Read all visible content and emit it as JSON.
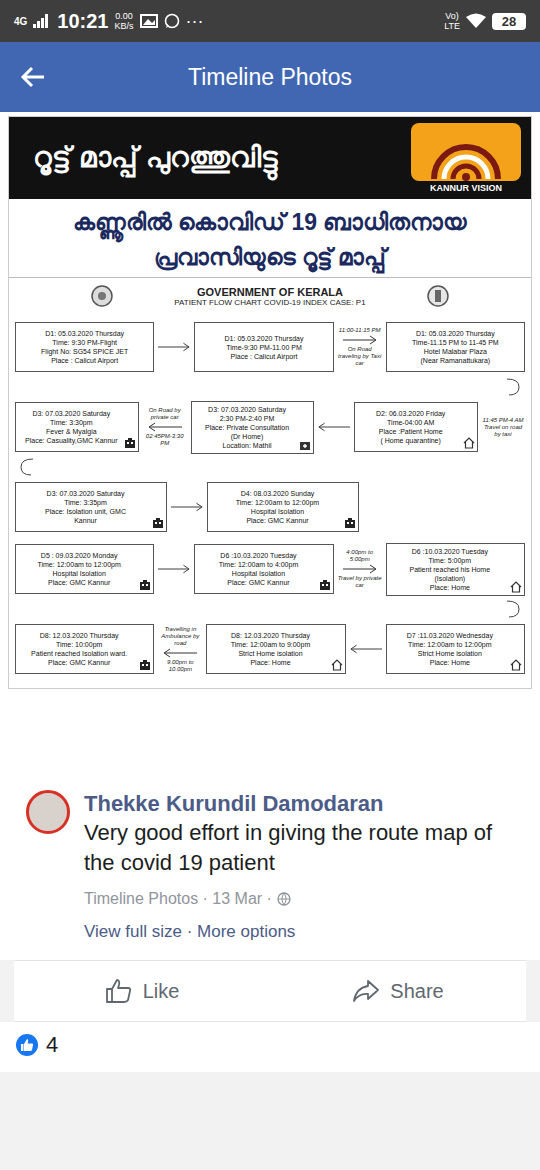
{
  "status_bar": {
    "network": "4G",
    "time": "10:21",
    "speed": "0.00",
    "speed_unit": "KB/s",
    "more": "···",
    "volte_top": "Vo)",
    "volte_bottom": "LTE",
    "battery": "28"
  },
  "app_bar": {
    "title": "Timeline Photos"
  },
  "photo": {
    "banner": "റൂട്ട് മാപ്പ് പുറത്തുവിട്ടു",
    "logo": "KANNUR VISION",
    "headline": [
      "കണ്ണൂരിൽ കൊവിഡ് 19 ബാധിതനായ",
      "പ്രവാസിയുടെ റൂട്ട് മാപ്പ്"
    ],
    "chart_title": "GOVERNMENT OF KERALA",
    "chart_subtitle": "PATIENT FLOW CHART COVID-19 INDEX CASE: P1",
    "rows": [
      {
        "turn": "right",
        "cells": [
          {
            "kind": "plain",
            "lines": [
              "D1: 05.03.2020 Thursday",
              "Time: 9:30 PM-Flight",
              "Flight No: SG54 SPICE JET",
              "Place : Calicut Airport"
            ]
          },
          {
            "kind": "arrow",
            "direction": "right",
            "labels": []
          },
          {
            "kind": "plain",
            "lines": [
              "D1: 05.03.2020 Thursday",
              "Time-9:30 PM-11.00 PM",
              "Place : Calicut Airport"
            ]
          },
          {
            "kind": "arrow",
            "direction": "right",
            "labels": [
              "11:00-11:15 PM",
              "On Road traveling by Taxi car"
            ]
          },
          {
            "kind": "plain",
            "lines": [
              "D1: 05.03.2020 Thursday",
              "Time-11.15 PM to 11-45 PM",
              "Hotel Malabar Plaza",
              "(Near Ramanattukara)"
            ]
          }
        ]
      },
      {
        "turn": "left",
        "cells": [
          {
            "kind": "hospital",
            "lines": [
              "D3: 07.03.2020 Saturday",
              "Time: 3:30pm",
              "Fever & Myalgia",
              "Place: Casuality,GMC Kannur"
            ]
          },
          {
            "kind": "arrow",
            "direction": "left",
            "labels": [
              "On Road by private car",
              "02:45PM-3:30 PM"
            ]
          },
          {
            "kind": "clinic",
            "lines": [
              "D3: 07.03.2020 Saturday",
              "2:30 PM-2:40 PM",
              "Place: Private Consultation",
              "(Dr Home)",
              "Location: Mathil"
            ]
          },
          {
            "kind": "arrow",
            "direction": "left",
            "labels": []
          },
          {
            "kind": "home",
            "lines": [
              "D2: 06.03.2020 Friday",
              "Time-04:00 AM",
              "Place :Patient Home",
              "( Home quarantine)"
            ]
          },
          {
            "kind": "note",
            "lines": [
              "11:45 PM-4 AM",
              "Travel on road by taxi"
            ]
          }
        ]
      },
      {
        "turn": "none",
        "cells": [
          {
            "kind": "hospital",
            "lines": [
              "D3: 07.03.2020 Saturday",
              "Time: 3:35pm",
              "Place: Isolation unit, GMC",
              "Kannur"
            ]
          },
          {
            "kind": "arrow",
            "direction": "right",
            "labels": []
          },
          {
            "kind": "hospital",
            "lines": [
              "D4: 08.03.2020 Sunday",
              "Time: 12:00am to 12:00pm",
              "Hospital Isolation",
              "Place: GMC Kannur"
            ]
          }
        ]
      },
      {
        "turn": "right",
        "cells": [
          {
            "kind": "hospital",
            "lines": [
              "D5 : 09.03.2020 Monday",
              "Time: 12:00am to 12:00pm",
              "Hospital Isolation",
              "Place: GMC Kannur"
            ]
          },
          {
            "kind": "arrow",
            "direction": "right",
            "labels": []
          },
          {
            "kind": "hospital",
            "lines": [
              "D6 :10.03.2020 Tuesday",
              "Time: 12:00am to 4:00pm",
              "Hospital Isolation",
              "Place: GMC Kannur"
            ]
          },
          {
            "kind": "arrow",
            "direction": "right",
            "labels": [
              "4:00pm to 5:00pm",
              "Travel by private car"
            ]
          },
          {
            "kind": "home",
            "lines": [
              "D6 :10.03.2020 Tuesday",
              "Time: 5:00pm",
              "Patient reached his Home",
              "(Isolation)",
              "Place: Home"
            ]
          }
        ]
      },
      {
        "turn": "none",
        "cells": [
          {
            "kind": "hospital",
            "lines": [
              "D8: 12.03.2020 Thursday",
              "Time: 10:00pm",
              "Patient reached Isolation ward.",
              "Place: GMC Kannur"
            ]
          },
          {
            "kind": "arrow",
            "direction": "left",
            "labels": [
              "Travelling in Ambulance by road",
              "9.00pm to 10.00pm"
            ]
          },
          {
            "kind": "home",
            "lines": [
              "D8: 12.03.2020 Thursday",
              "Time: 12:00am to 9:00pm",
              "Strict Home isolation",
              "Place: Home"
            ]
          },
          {
            "kind": "arrow",
            "direction": "left",
            "labels": []
          },
          {
            "kind": "home",
            "lines": [
              "D7 :11.03.2020 Wednesday",
              "Time: 12:00am to 12:00pm",
              "Strict Home isolation",
              "Place: Home"
            ]
          }
        ]
      }
    ]
  },
  "comment": {
    "author": "Thekke Kurundil Damodaran",
    "text": "Very good effort in giving the route map of the covid 19 patient",
    "meta": "Timeline Photos · 13 Mar ·",
    "links": "View full size · More options"
  },
  "actions": [
    {
      "label": "Like"
    },
    {
      "label": "Share"
    }
  ],
  "reactions": {
    "count": "4"
  }
}
